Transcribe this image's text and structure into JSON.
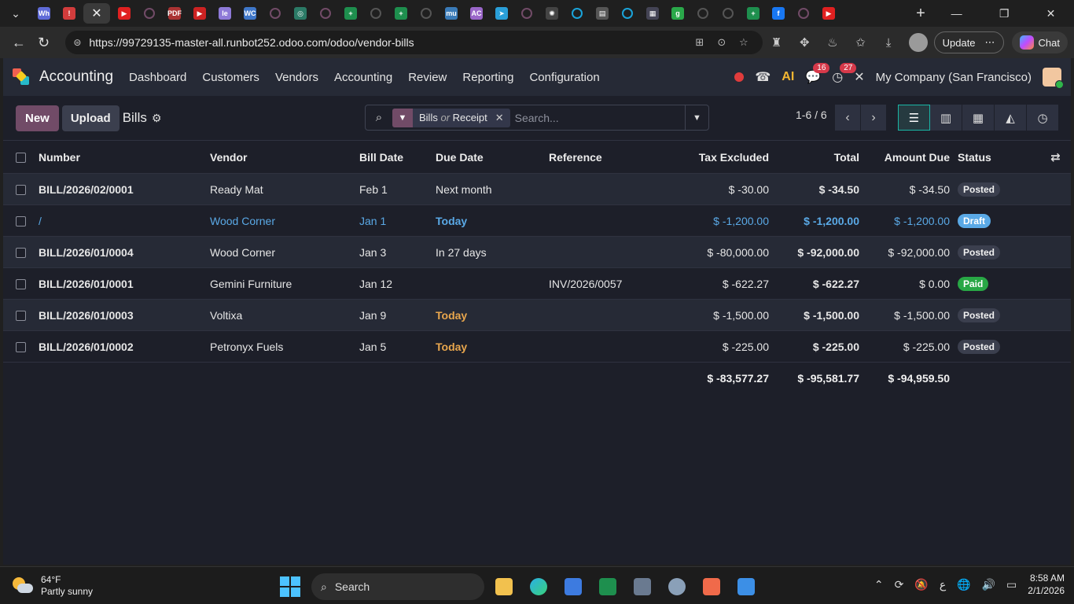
{
  "browser": {
    "tabs": [
      {
        "icon": "whatsapp-icon",
        "label": "Wh",
        "color": "#5f6bd8"
      },
      {
        "icon": "alert-icon",
        "label": "!",
        "color": "#d23c3c"
      },
      {
        "icon": "close-icon",
        "label": "✕",
        "color": "#3a3a3a",
        "active": true
      },
      {
        "icon": "youtube-icon",
        "label": "▶",
        "color": "#e02020"
      },
      {
        "icon": "circle-icon",
        "label": "",
        "color": "#714b67"
      },
      {
        "icon": "pdf-icon",
        "label": "PDF",
        "color": "#a33"
      },
      {
        "icon": "youtube-icon",
        "label": "▶",
        "color": "#c22"
      },
      {
        "icon": "le-icon",
        "label": "le",
        "color": "#8e7ad8"
      },
      {
        "icon": "wc-icon",
        "label": "WC",
        "color": "#3f77c9"
      },
      {
        "icon": "circle-icon",
        "label": "",
        "color": "#714b67"
      },
      {
        "icon": "chatgpt-icon",
        "label": "◎",
        "color": "#2b7a66"
      },
      {
        "icon": "circle-icon",
        "label": "",
        "color": "#714b67"
      },
      {
        "icon": "sheets-icon",
        "label": "+",
        "color": "#1e8f4e"
      },
      {
        "icon": "circle-icon",
        "label": "",
        "color": "#555"
      },
      {
        "icon": "sheets-icon",
        "label": "+",
        "color": "#1e8f4e"
      },
      {
        "icon": "circle-icon",
        "label": "",
        "color": "#555"
      },
      {
        "icon": "mu-icon",
        "label": "mu",
        "color": "#3a7bb8"
      },
      {
        "icon": "ac-icon",
        "label": "AC",
        "color": "#9a66c9"
      },
      {
        "icon": "telegram-icon",
        "label": "➤",
        "color": "#2a9fd9"
      },
      {
        "icon": "circle-icon",
        "label": "",
        "color": "#714b67"
      },
      {
        "icon": "openai-icon",
        "label": "✺",
        "color": "#444"
      },
      {
        "icon": "circle-icon",
        "label": "",
        "color": "#1aa3d9"
      },
      {
        "icon": "doc-icon",
        "label": "▤",
        "color": "#555"
      },
      {
        "icon": "circle-icon",
        "label": "",
        "color": "#1aa3d9"
      },
      {
        "icon": "grid-icon",
        "label": "▦",
        "color": "#445"
      },
      {
        "icon": "green-icon",
        "label": "g",
        "color": "#2aa84a"
      },
      {
        "icon": "circle-icon",
        "label": "",
        "color": "#555"
      },
      {
        "icon": "circle-icon",
        "label": "",
        "color": "#555"
      },
      {
        "icon": "sheets-icon",
        "label": "+",
        "color": "#1e8f4e"
      },
      {
        "icon": "facebook-icon",
        "label": "f",
        "color": "#1877f2"
      },
      {
        "icon": "circle-icon",
        "label": "",
        "color": "#714b67"
      },
      {
        "icon": "youtube-icon",
        "label": "▶",
        "color": "#e02020"
      }
    ],
    "url": "https://99729135-master-all.runbot252.odoo.com/odoo/vendor-bills",
    "update_label": "Update",
    "chat_label": "Chat"
  },
  "app": {
    "name": "Accounting",
    "menu": [
      "Dashboard",
      "Customers",
      "Vendors",
      "Accounting",
      "Review",
      "Reporting",
      "Configuration"
    ],
    "messages_badge": "16",
    "activity_badge": "27",
    "company": "My Company (San Francisco)"
  },
  "control": {
    "new_label": "New",
    "upload_label": "Upload",
    "breadcrumb": "Bills",
    "facet_label": "Bills",
    "facet_or": "or",
    "facet_label2": "Receipt",
    "search_placeholder": "Search...",
    "pager": "1-6 / 6"
  },
  "table": {
    "headers": {
      "number": "Number",
      "vendor": "Vendor",
      "bill_date": "Bill Date",
      "due_date": "Due Date",
      "reference": "Reference",
      "tax_excluded": "Tax Excluded",
      "total": "Total",
      "amount_due": "Amount Due",
      "status": "Status"
    },
    "rows": [
      {
        "number": "BILL/2026/02/0001",
        "vendor": "Ready Mat",
        "bill_date": "Feb 1",
        "due_date": "Next month",
        "due_today": false,
        "reference": "",
        "tax_excluded": "$ -30.00",
        "total": "$ -34.50",
        "amount_due": "$ -34.50",
        "status": "Posted",
        "status_kind": "posted",
        "draft": false
      },
      {
        "number": "/",
        "vendor": "Wood Corner",
        "bill_date": "Jan 1",
        "due_date": "Today",
        "due_today": true,
        "reference": "",
        "tax_excluded": "$ -1,200.00",
        "total": "$ -1,200.00",
        "amount_due": "$ -1,200.00",
        "status": "Draft",
        "status_kind": "draft",
        "draft": true
      },
      {
        "number": "BILL/2026/01/0004",
        "vendor": "Wood Corner",
        "bill_date": "Jan 3",
        "due_date": "In 27 days",
        "due_today": false,
        "reference": "",
        "tax_excluded": "$ -80,000.00",
        "total": "$ -92,000.00",
        "amount_due": "$ -92,000.00",
        "status": "Posted",
        "status_kind": "posted",
        "draft": false
      },
      {
        "number": "BILL/2026/01/0001",
        "vendor": "Gemini Furniture",
        "bill_date": "Jan 12",
        "due_date": "",
        "due_today": false,
        "reference": "INV/2026/0057",
        "tax_excluded": "$ -622.27",
        "total": "$ -622.27",
        "amount_due": "$ 0.00",
        "status": "Paid",
        "status_kind": "paid",
        "draft": false
      },
      {
        "number": "BILL/2026/01/0003",
        "vendor": "Voltixa",
        "bill_date": "Jan 9",
        "due_date": "Today",
        "due_today": true,
        "reference": "",
        "tax_excluded": "$ -1,500.00",
        "total": "$ -1,500.00",
        "amount_due": "$ -1,500.00",
        "status": "Posted",
        "status_kind": "posted",
        "draft": false
      },
      {
        "number": "BILL/2026/01/0002",
        "vendor": "Petronyx Fuels",
        "bill_date": "Jan 5",
        "due_date": "Today",
        "due_today": true,
        "reference": "",
        "tax_excluded": "$ -225.00",
        "total": "$ -225.00",
        "amount_due": "$ -225.00",
        "status": "Posted",
        "status_kind": "posted",
        "draft": false
      }
    ],
    "totals": {
      "tax_excluded": "$ -83,577.27",
      "total": "$ -95,581.77",
      "amount_due": "$ -94,959.50"
    }
  },
  "taskbar": {
    "temperature": "64°F",
    "weather": "Partly sunny",
    "search_label": "Search",
    "time": "8:58 AM",
    "date": "2/1/2026",
    "lang": "ع"
  }
}
